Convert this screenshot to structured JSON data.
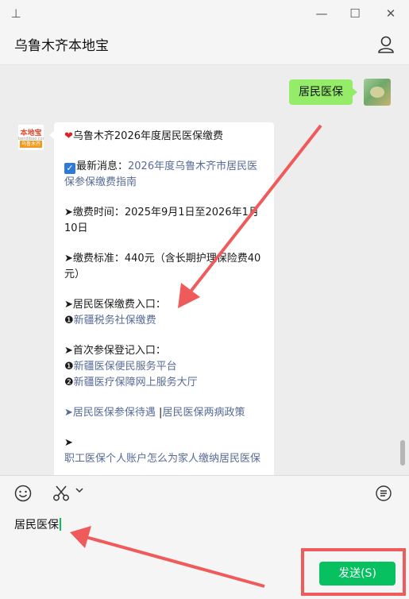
{
  "header": {
    "title": "乌鲁木齐本地宝"
  },
  "window": {
    "pin": "⊥",
    "minimize": "—",
    "maximize": "☐",
    "close": "✕"
  },
  "chat": {
    "my_message": "居民医保",
    "bot_avatar": {
      "top": "本地宝",
      "mid": "bendibao.com",
      "bottom": "乌鲁木齐"
    },
    "message": {
      "title": "乌鲁木齐2026年度居民医保缴费",
      "latest_label": "最新消息：",
      "latest_link": "2026年度乌鲁木齐市居民医保参保缴费指南",
      "time_line": "➤缴费时间：2025年9月1日至2026年1月10日",
      "standard_line": "➤缴费标准：440元（含长期护理保险费40元）",
      "entry_label": "➤居民医保缴费入口：",
      "entry_bullet": "❶",
      "entry_link": "新疆税务社保缴费",
      "first_label": "➤首次参保登记入口：",
      "first_bullet_1": "❶",
      "first_link_1": "新疆医保便民服务平台",
      "first_bullet_2": "❷",
      "first_link_2": "新疆医疗保障网上服务大厅",
      "policy_prefix": "➤",
      "policy_link_1": "居民医保参保待遇",
      "policy_sep": " |",
      "policy_link_2": "居民医保两病政策",
      "last_prefix": "➤",
      "last_link": "职工医保个人账户怎么为家人缴纳居民医保"
    }
  },
  "input": {
    "text": "居民医保",
    "send_label": "发送(S)"
  },
  "icons": {
    "emoji": "emoji-icon",
    "scissors": "scissors-icon",
    "history": "chat-history-icon",
    "user": "user-icon"
  },
  "colors": {
    "accent": "#07c160",
    "bubble": "#95ec69",
    "link": "#576b95",
    "annotation": "#ef5b5b"
  }
}
